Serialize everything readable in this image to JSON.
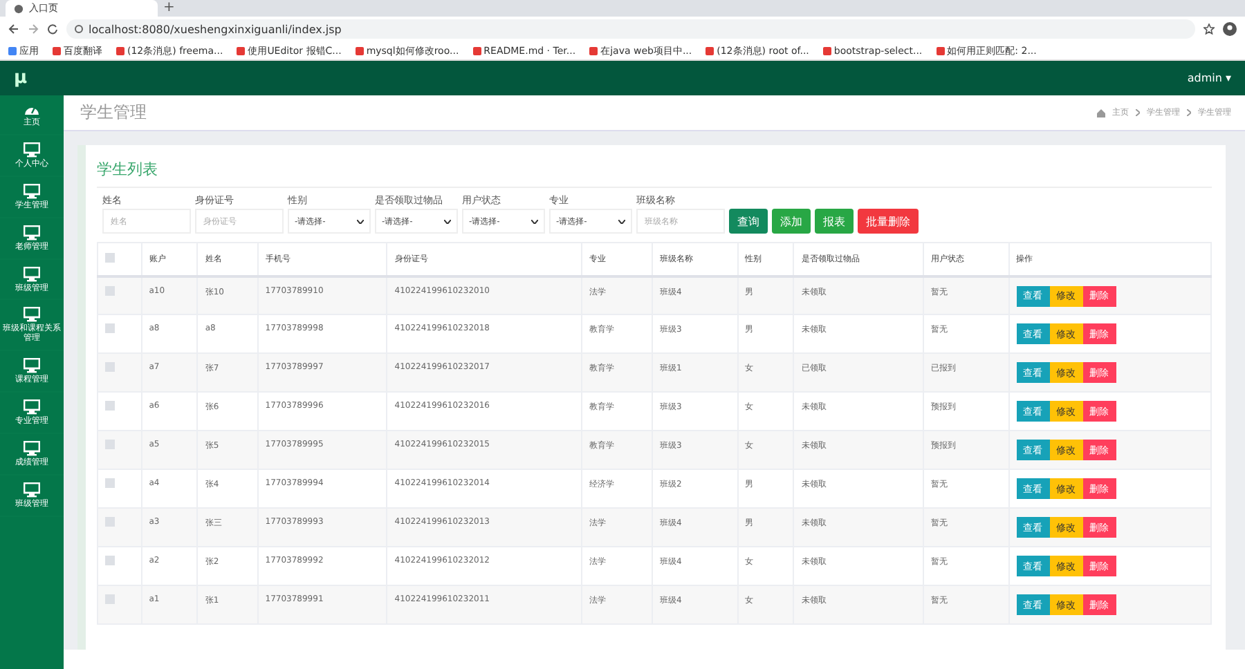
{
  "browser": {
    "tab_title": "入口页",
    "new_tab": "+",
    "url": "localhost:8080/xueshengxinxiguanli/index.jsp",
    "bookmarks": [
      "应用",
      "百度翻译",
      "(12条消息) freema...",
      "使用UEditor 报错C...",
      "mysql如何修改roo...",
      "README.md · Ter...",
      "在java web项目中...",
      "(12条消息) root of...",
      "bootstrap-select...",
      "如何用正则匹配: 2..."
    ]
  },
  "topbar": {
    "logo": "μ",
    "user": "admin ▾"
  },
  "sidebar": {
    "items": [
      {
        "label": "主页",
        "kind": "gauge"
      },
      {
        "label": "个人中心",
        "kind": "monitor"
      },
      {
        "label": "学生管理",
        "kind": "monitor"
      },
      {
        "label": "老师管理",
        "kind": "monitor"
      },
      {
        "label": "班级管理",
        "kind": "monitor"
      },
      {
        "label": "班级和课程关系管理",
        "kind": "monitor"
      },
      {
        "label": "课程管理",
        "kind": "monitor"
      },
      {
        "label": "专业管理",
        "kind": "monitor"
      },
      {
        "label": "成绩管理",
        "kind": "monitor"
      },
      {
        "label": "班级管理",
        "kind": "monitor"
      }
    ]
  },
  "page": {
    "title": "学生管理",
    "breadcrumb": [
      "主页",
      "学生管理",
      "学生管理"
    ]
  },
  "card": {
    "title": "学生列表",
    "filters": [
      {
        "label": "姓名",
        "kind": "text",
        "placeholder": "姓名"
      },
      {
        "label": "身份证号",
        "kind": "text",
        "placeholder": "身份证号"
      },
      {
        "label": "性别",
        "kind": "select",
        "value": "-请选择-"
      },
      {
        "label": "是否领取过物品",
        "kind": "select",
        "value": "-请选择-"
      },
      {
        "label": "用户状态",
        "kind": "select",
        "value": "-请选择-"
      },
      {
        "label": "专业",
        "kind": "select",
        "value": "-请选择-"
      },
      {
        "label": "班级名称",
        "kind": "text",
        "placeholder": "班级名称"
      }
    ],
    "buttons": [
      {
        "label": "查询",
        "kind": "query"
      },
      {
        "label": "添加",
        "kind": "add"
      },
      {
        "label": "报表",
        "kind": "add"
      },
      {
        "label": "批量删除",
        "kind": "danger"
      }
    ],
    "table": {
      "select_all_checked": false,
      "columns": [
        "账户",
        "姓名",
        "手机号",
        "身份证号",
        "专业",
        "班级名称",
        "性别",
        "是否领取过物品",
        "用户状态",
        "操作"
      ],
      "rows": [
        {
          "checked": false,
          "cells": [
            "a10",
            "张10",
            "17703789910",
            "410224199610232010",
            "法学",
            "班级4",
            "男",
            "未领取",
            "暂无"
          ],
          "actions": [
            "查看",
            "修改",
            "删除"
          ]
        },
        {
          "checked": false,
          "cells": [
            "a8",
            "a8",
            "17703789998",
            "410224199610232018",
            "教育学",
            "班级3",
            "男",
            "未领取",
            "暂无"
          ],
          "actions": [
            "查看",
            "修改",
            "删除"
          ]
        },
        {
          "checked": false,
          "cells": [
            "a7",
            "张7",
            "17703789997",
            "410224199610232017",
            "教育学",
            "班级1",
            "女",
            "已领取",
            "已报到"
          ],
          "actions": [
            "查看",
            "修改",
            "删除"
          ]
        },
        {
          "checked": false,
          "cells": [
            "a6",
            "张6",
            "17703789996",
            "410224199610232016",
            "教育学",
            "班级3",
            "女",
            "未领取",
            "预报到"
          ],
          "actions": [
            "查看",
            "修改",
            "删除"
          ]
        },
        {
          "checked": false,
          "cells": [
            "a5",
            "张5",
            "17703789995",
            "410224199610232015",
            "教育学",
            "班级3",
            "女",
            "未领取",
            "预报到"
          ],
          "actions": [
            "查看",
            "修改",
            "删除"
          ]
        },
        {
          "checked": false,
          "cells": [
            "a4",
            "张4",
            "17703789994",
            "410224199610232014",
            "经济学",
            "班级2",
            "男",
            "未领取",
            "暂无"
          ],
          "actions": [
            "查看",
            "修改",
            "删除"
          ]
        },
        {
          "checked": false,
          "cells": [
            "a3",
            "张三",
            "17703789993",
            "410224199610232013",
            "法学",
            "班级4",
            "男",
            "未领取",
            "暂无"
          ],
          "actions": [
            "查看",
            "修改",
            "删除"
          ]
        },
        {
          "checked": false,
          "cells": [
            "a2",
            "张2",
            "17703789992",
            "410224199610232012",
            "法学",
            "班级4",
            "女",
            "未领取",
            "暂无"
          ],
          "actions": [
            "查看",
            "修改",
            "删除"
          ]
        },
        {
          "checked": false,
          "cells": [
            "a1",
            "张1",
            "17703789991",
            "410224199610232011",
            "法学",
            "班级4",
            "女",
            "未领取",
            "暂无"
          ],
          "actions": [
            "查看",
            "修改",
            "删除"
          ]
        }
      ]
    }
  }
}
